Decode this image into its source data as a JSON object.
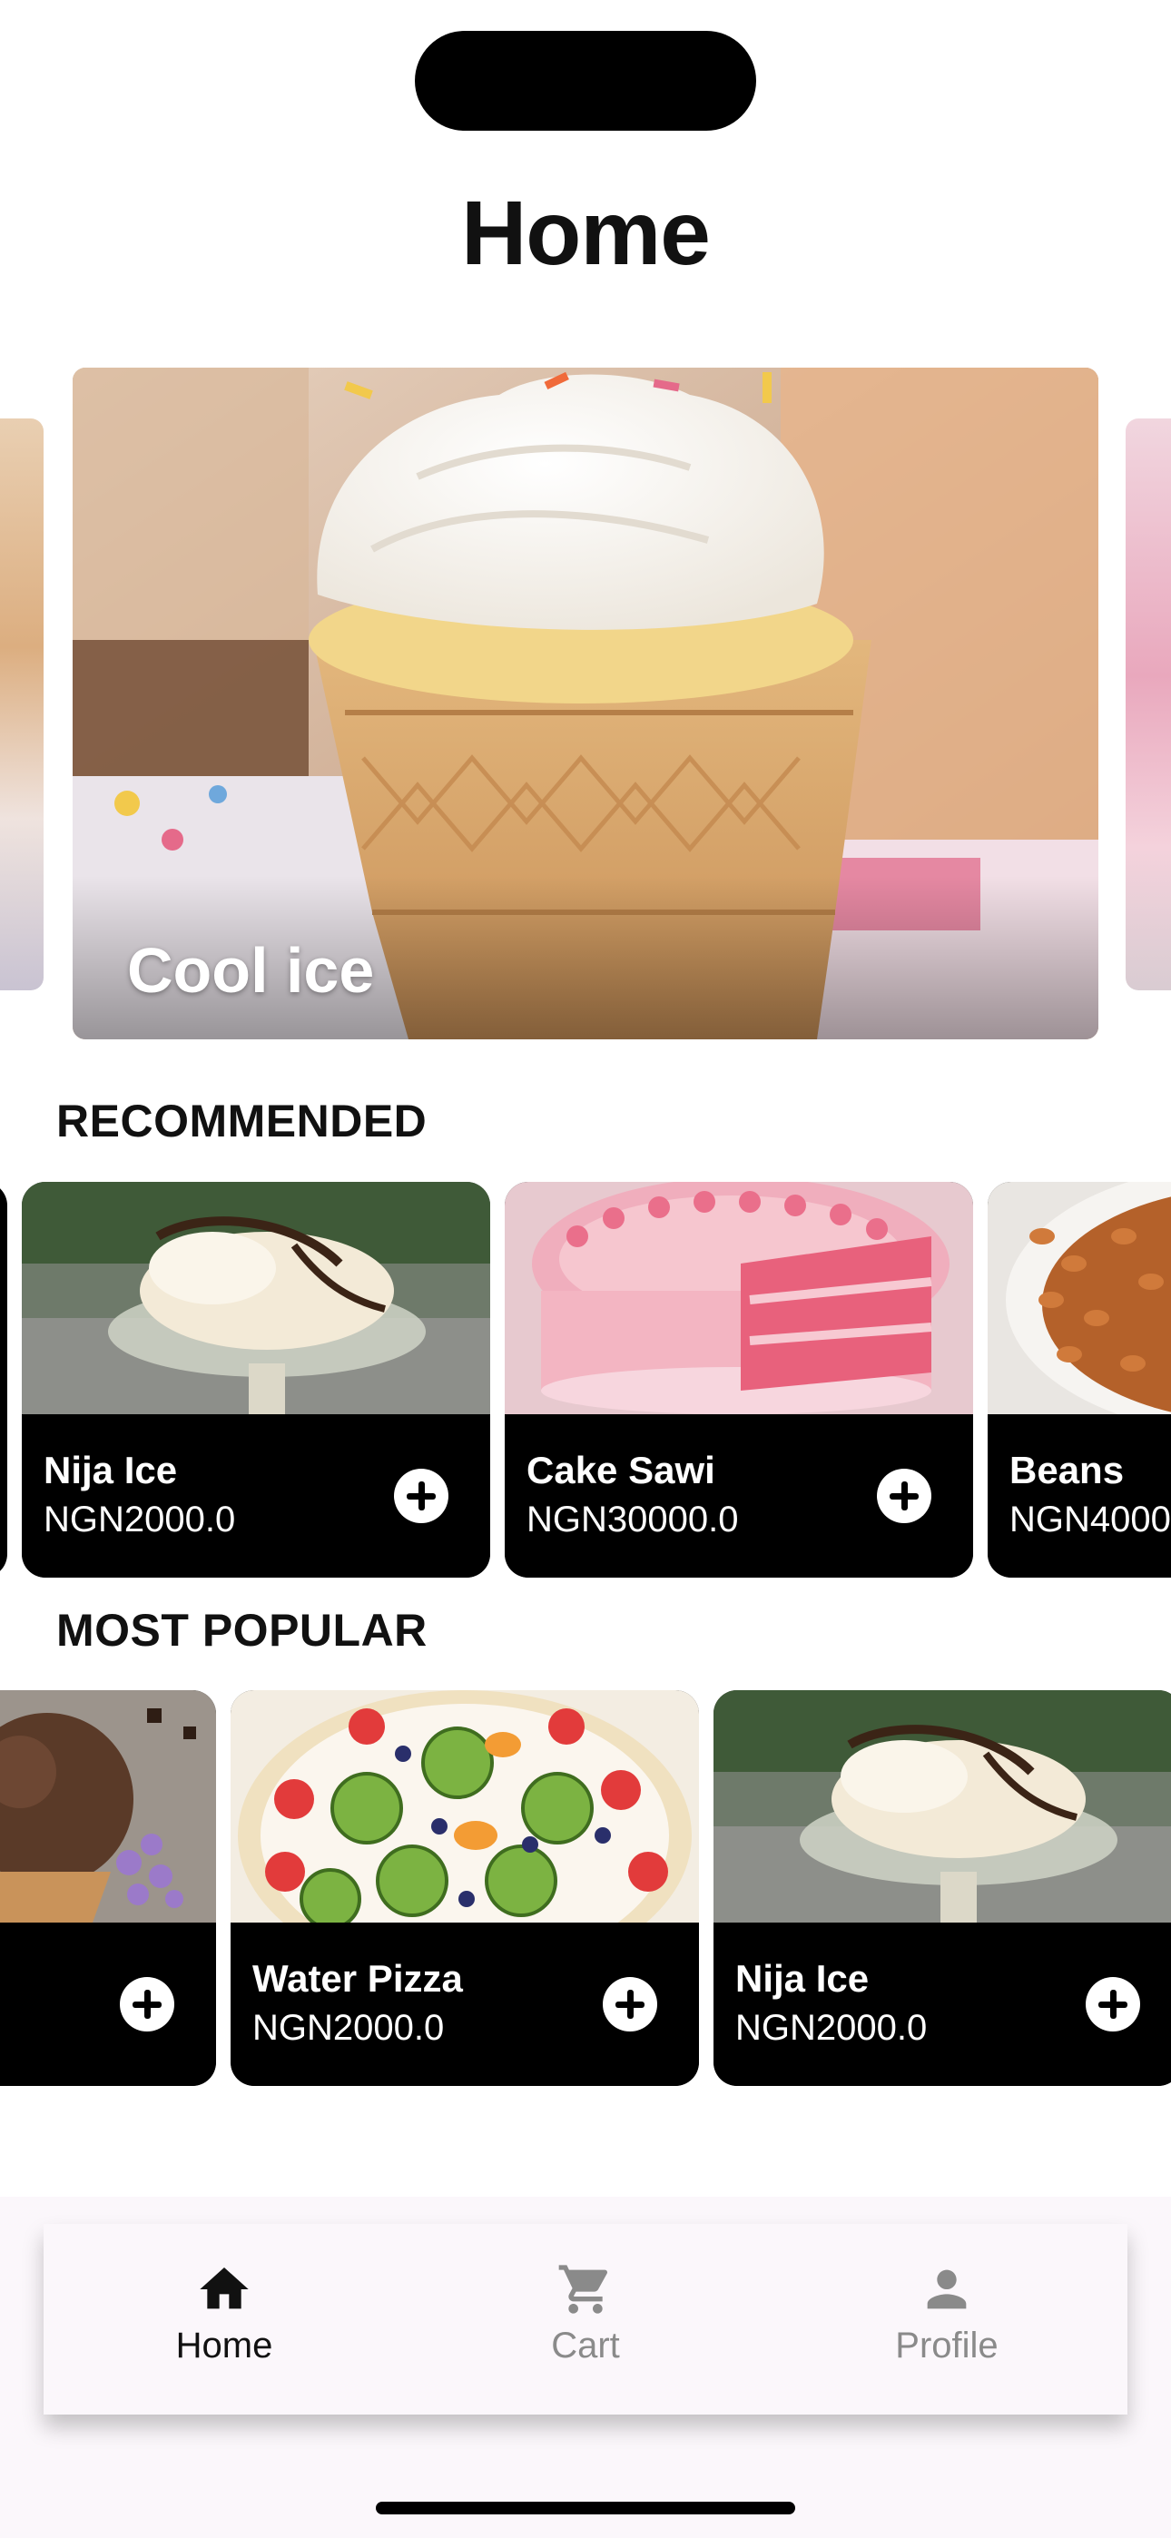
{
  "header": {
    "title": "Home"
  },
  "hero": {
    "slides": [
      {
        "label": "Cool ice"
      }
    ]
  },
  "recommended": {
    "title": "RECOMMENDED",
    "items": [
      {
        "name": "Nija Ice",
        "price": "NGN2000.0"
      },
      {
        "name": "Cake Sawi",
        "price": "NGN30000.0"
      },
      {
        "name": "Beans",
        "price": "NGN4000"
      }
    ]
  },
  "popular": {
    "title": "MOST POPULAR",
    "items": [
      {
        "name": "",
        "price": ""
      },
      {
        "name": "Water Pizza",
        "price": "NGN2000.0"
      },
      {
        "name": "Nija Ice",
        "price": "NGN2000.0"
      }
    ]
  },
  "nav": {
    "items": [
      {
        "label": "Home",
        "icon": "home-icon",
        "active": true
      },
      {
        "label": "Cart",
        "icon": "cart-icon",
        "active": false
      },
      {
        "label": "Profile",
        "icon": "person-icon",
        "active": false
      }
    ]
  },
  "colors": {
    "accent": "#000000",
    "background": "#ffffff",
    "nav_background": "#fbf7fb",
    "inactive": "#8a8a8a"
  }
}
